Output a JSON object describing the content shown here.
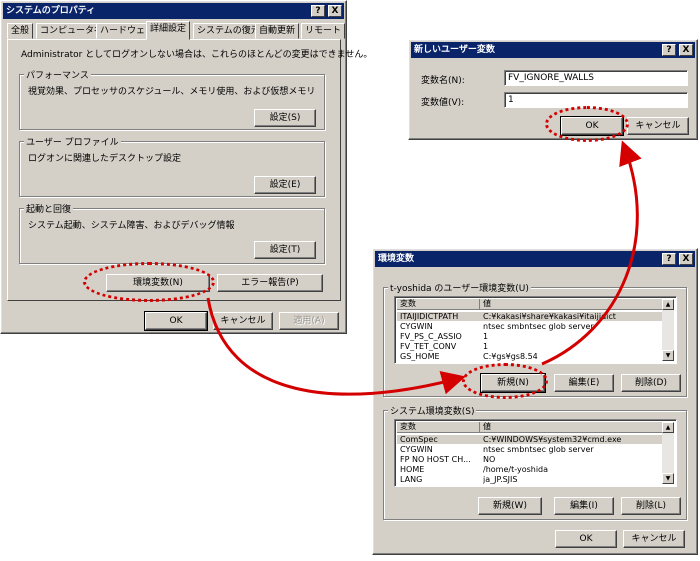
{
  "sys": {
    "title": "システムのプロパティ",
    "help_btn": "?",
    "close_btn": "X",
    "tabs": [
      "全般",
      "コンピュータ名",
      "ハードウェア",
      "詳細設定",
      "システムの復元",
      "自動更新",
      "リモート"
    ],
    "notice": "Administrator としてログオンしない場合は、これらのほとんどの変更はできません。",
    "perf": {
      "title": "パフォーマンス",
      "desc": "視覚効果、プロセッサのスケジュール、メモリ使用、および仮想メモリ",
      "button": "設定(S)"
    },
    "profile": {
      "title": "ユーザー プロファイル",
      "desc": "ログオンに関連したデスクトップ設定",
      "button": "設定(E)"
    },
    "startup": {
      "title": "起動と回復",
      "desc": "システム起動、システム障害、およびデバッグ情報",
      "button": "設定(T)"
    },
    "env_button": "環境変数(N)",
    "error_button": "エラー報告(P)",
    "ok": "OK",
    "cancel": "キャンセル",
    "apply": "適用(A)"
  },
  "newvar": {
    "title": "新しいユーザー変数",
    "help_btn": "?",
    "close_btn": "X",
    "name_label": "変数名(N):",
    "name_value": "FV_IGNORE_WALLS",
    "value_label": "変数値(V):",
    "value_value": "1",
    "ok": "OK",
    "cancel": "キャンセル"
  },
  "env": {
    "title": "環境変数",
    "help_btn": "?",
    "close_btn": "X",
    "user_group": "t-yoshida のユーザー環境変数(U)",
    "col_var": "変数",
    "col_val": "値",
    "user_rows": [
      {
        "name": "ITAIJIDICTPATH",
        "value": "C:¥kakasi¥share¥kakasi¥itaijidict"
      },
      {
        "name": "CYGWIN",
        "value": "ntsec smbntsec glob server"
      },
      {
        "name": "FV_PS_C_ASSIO",
        "value": "1"
      },
      {
        "name": "FV_TET_CONV",
        "value": "1"
      },
      {
        "name": "GS_HOME",
        "value": "C:¥gs¥gs8.54"
      }
    ],
    "new": "新規(N)",
    "edit": "編集(E)",
    "delete": "削除(D)",
    "sys_group": "システム環境変数(S)",
    "sys_rows": [
      {
        "name": "ComSpec",
        "value": "C:¥WINDOWS¥system32¥cmd.exe"
      },
      {
        "name": "CYGWIN",
        "value": "ntsec smbntsec glob server"
      },
      {
        "name": "FP NO HOST CH...",
        "value": "NO"
      },
      {
        "name": "HOME",
        "value": "/home/t-yoshida"
      },
      {
        "name": "LANG",
        "value": "ja_JP.SJIS"
      }
    ],
    "sys_new": "新規(W)",
    "sys_edit": "編集(I)",
    "sys_delete": "削除(L)",
    "ok": "OK",
    "cancel": "キャンセル"
  },
  "colors": {
    "annotation": "#d40000",
    "titlebar": "#0a246a",
    "dialog_face": "#d4d0c8"
  }
}
